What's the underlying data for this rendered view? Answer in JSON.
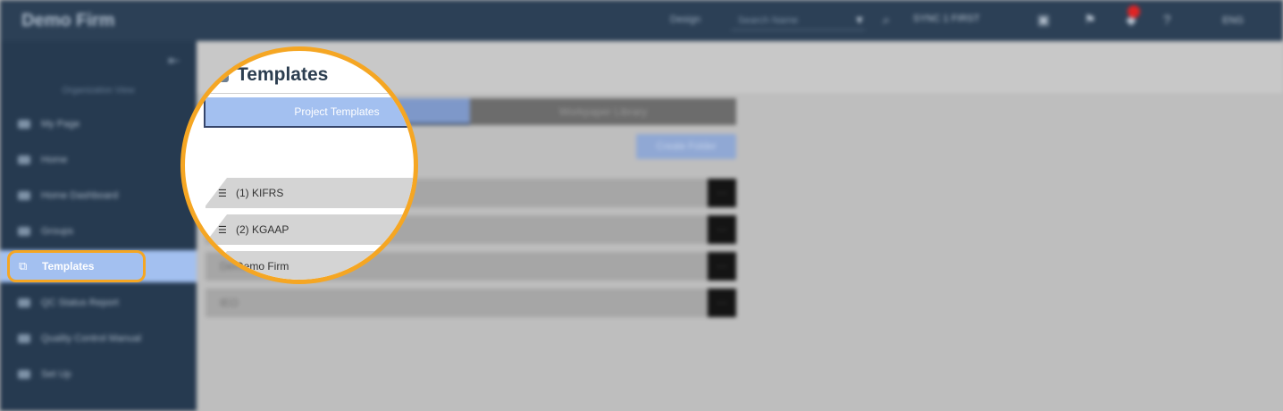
{
  "app": {
    "firm_name": "Demo Firm",
    "top_items": [
      "Design",
      "Search Name",
      "SYNC",
      "1 FIRST",
      "ENG"
    ]
  },
  "sidebar": {
    "caption": "Organization View",
    "items": [
      {
        "label": "My Page"
      },
      {
        "label": "Home"
      },
      {
        "label": "Home Dashboard"
      },
      {
        "label": "Groups"
      },
      {
        "label": "Templates",
        "active": true
      },
      {
        "label": "QC Status Report"
      },
      {
        "label": "Quality Control Manual"
      },
      {
        "label": "Set Up"
      }
    ]
  },
  "page": {
    "title": "Templates",
    "tabs": [
      {
        "label": "Project Templates",
        "active": true
      },
      {
        "label": "Workpaper Library",
        "active": false
      }
    ],
    "create_button": "Create Folder",
    "templates": [
      {
        "label": "(1) KIFRS"
      },
      {
        "label": "(2) KGAAP"
      },
      {
        "label": "Demo Firm"
      },
      {
        "label": "IEO"
      }
    ]
  },
  "colors": {
    "highlight_ring": "#f5a623",
    "active_tab": "#a3c0f0",
    "topbar": "#2c4056"
  }
}
